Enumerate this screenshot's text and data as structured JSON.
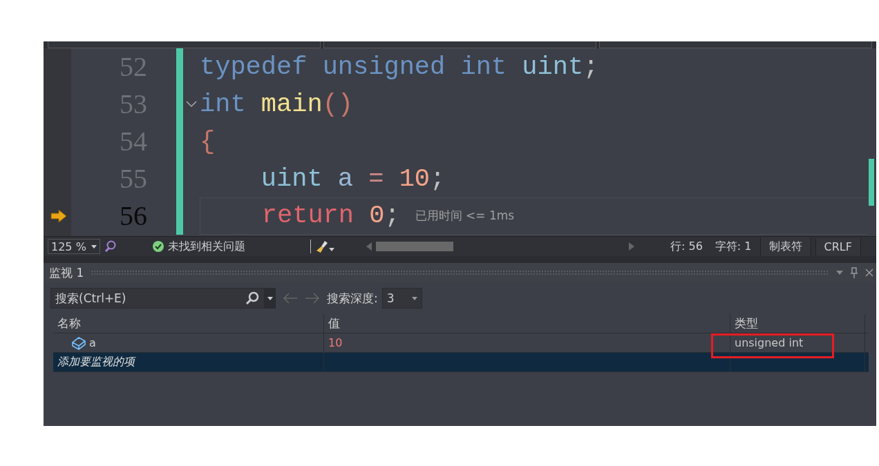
{
  "editor": {
    "lines": [
      {
        "number": "52",
        "current": false,
        "fold": false,
        "indent": false,
        "tokens": [
          {
            "kind": "keyword",
            "text": "typedef",
            "sp": true
          },
          {
            "kind": "keyword",
            "text": "unsigned",
            "sp": true
          },
          {
            "kind": "keyword",
            "text": "int",
            "sp": true
          },
          {
            "kind": "type",
            "text": "uint",
            "sp": false
          },
          {
            "kind": "punct",
            "text": ";",
            "sp": false
          }
        ]
      },
      {
        "number": "53",
        "current": false,
        "fold": true,
        "indent": false,
        "tokens": [
          {
            "kind": "keyword",
            "text": "int",
            "sp": true
          },
          {
            "kind": "func",
            "text": "main",
            "sp": false
          },
          {
            "kind": "paren",
            "text": "()",
            "sp": false
          }
        ]
      },
      {
        "number": "54",
        "current": false,
        "fold": false,
        "indent": false,
        "tokens": [
          {
            "kind": "paren",
            "text": "{",
            "sp": false
          }
        ]
      },
      {
        "number": "55",
        "current": false,
        "fold": false,
        "indent": true,
        "tokens": [
          {
            "kind": "type",
            "text": "uint",
            "sp": true
          },
          {
            "kind": "ident",
            "text": "a",
            "sp": true
          },
          {
            "kind": "op",
            "text": "=",
            "sp": true
          },
          {
            "kind": "number",
            "text": "10",
            "sp": false
          },
          {
            "kind": "punct",
            "text": ";",
            "sp": false
          }
        ]
      },
      {
        "number": "56",
        "current": true,
        "fold": false,
        "indent": true,
        "hint": "已用时间 <= 1ms",
        "tokens": [
          {
            "kind": "control",
            "text": "return",
            "sp": true
          },
          {
            "kind": "number",
            "text": "0",
            "sp": false
          },
          {
            "kind": "punct",
            "text": ";",
            "sp": false
          }
        ]
      }
    ]
  },
  "status_bar": {
    "zoom": "125 %",
    "issues": "未找到相关问题",
    "line": "行: 56",
    "char": "字符: 1",
    "indent": "制表符",
    "eol": "CRLF"
  },
  "watch": {
    "title": "监视 1",
    "search": {
      "placeholder": "搜索(Ctrl+E)"
    },
    "depth_label": "搜索深度:",
    "depth": "3",
    "columns": [
      "名称",
      "值",
      "类型"
    ],
    "rows": [
      {
        "name": "a",
        "value": "10",
        "type": "unsigned int",
        "changed": true,
        "highlighted": true
      }
    ],
    "add_item": {
      "label": "添加要监视的项",
      "selected": true
    }
  }
}
